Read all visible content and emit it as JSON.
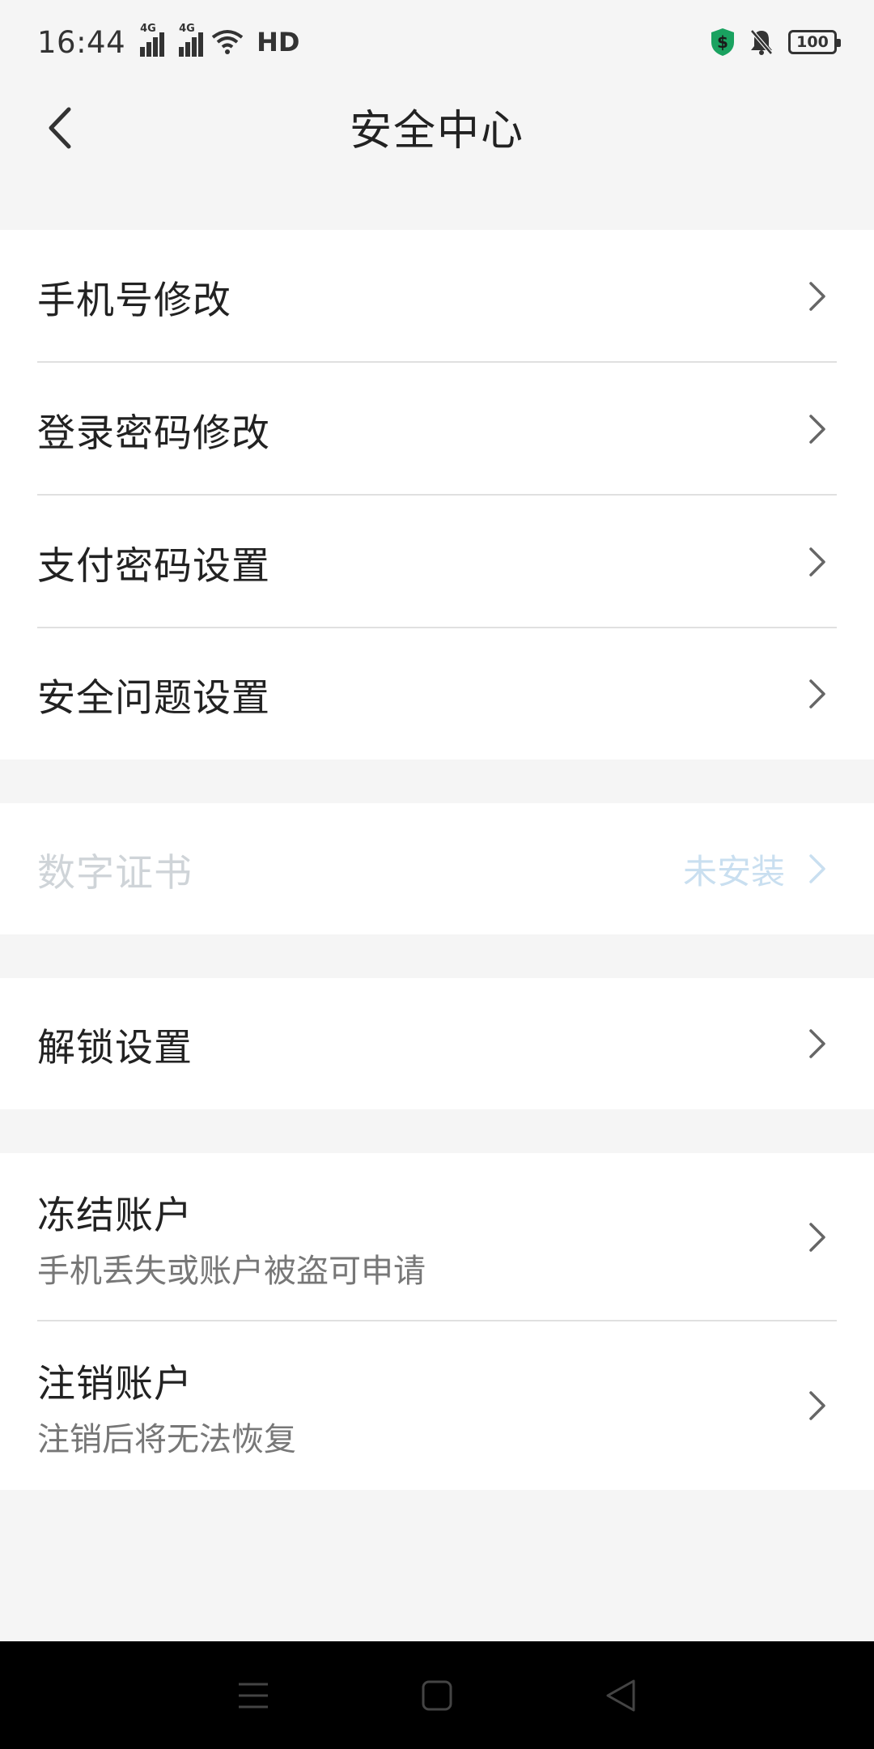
{
  "status_bar": {
    "time": "16:44",
    "network_1": "4G",
    "network_2": "4G",
    "hd": "HD",
    "battery": "100",
    "icons": [
      "signal-icon",
      "wifi-icon",
      "shield-dollar-icon",
      "bell-muted-icon",
      "battery-icon"
    ]
  },
  "header": {
    "title": "安全中心",
    "back_icon": "chevron-left-icon"
  },
  "group1": [
    {
      "label": "手机号修改"
    },
    {
      "label": "登录密码修改"
    },
    {
      "label": "支付密码设置"
    },
    {
      "label": "安全问题设置"
    }
  ],
  "group2": {
    "label": "数字证书",
    "status": "未安装"
  },
  "group3": {
    "label": "解锁设置"
  },
  "group4": [
    {
      "label": "冻结账户",
      "sub": "手机丢失或账户被盗可申请"
    },
    {
      "label": "注销账户",
      "sub": "注销后将无法恢复"
    }
  ],
  "colors": {
    "background": "#f5f5f5",
    "card": "#ffffff",
    "text": "#222222",
    "subtext": "#777777",
    "disabled_text": "#cfd4d8",
    "disabled_status": "#c9dff0",
    "shield_green": "#1aa260",
    "nav_bar": "#000000"
  }
}
